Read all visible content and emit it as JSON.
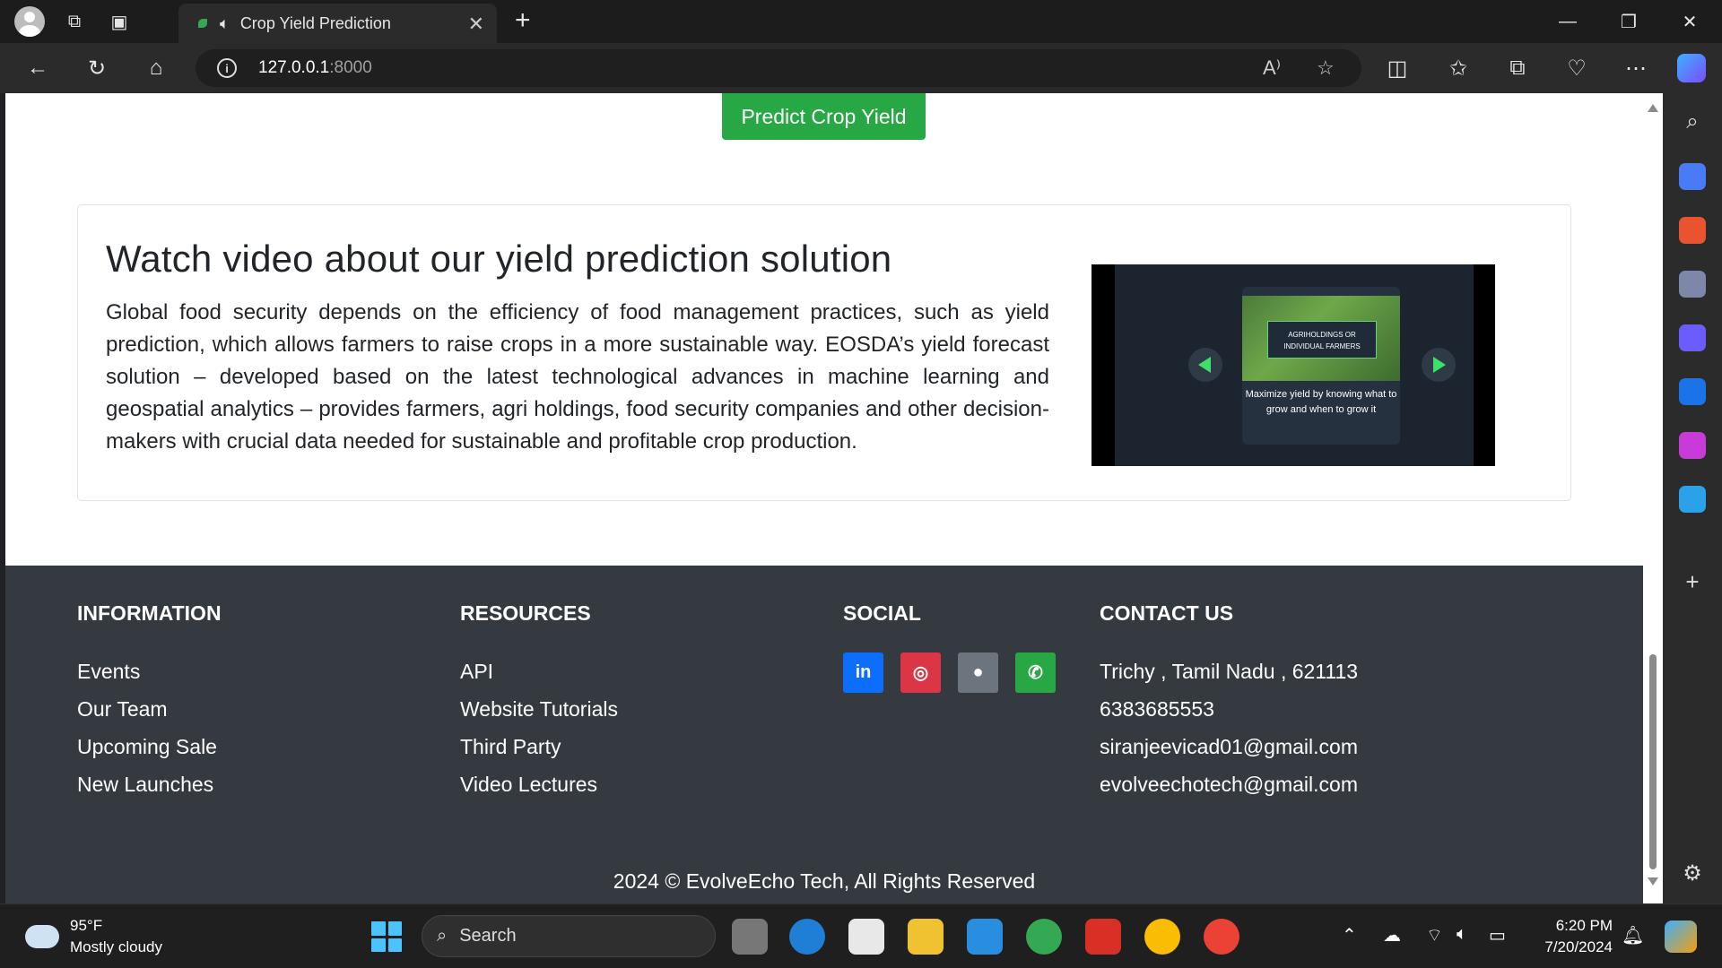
{
  "browser": {
    "tab_title": "Crop Yield Prediction",
    "url_host": "127.0.0.1",
    "url_port": ":8000"
  },
  "page": {
    "predict_button": "Predict Crop Yield",
    "video_section": {
      "heading": "Watch video about our yield prediction solution",
      "paragraph": "Global food security depends on the efficiency of food management practices, such as yield prediction, which allows farmers to raise crops in a more sustainable way. EOSDA’s yield forecast solution – developed based on the latest technological advances in machine learning and geospatial analytics – provides farmers, agri holdings, food security companies and other decision-makers with crucial data needed for sustainable and profitable crop production.",
      "video_tag": "AGRIHOLDINGS OR INDIVIDUAL FARMERS",
      "video_caption": "Maximize yield by knowing what to grow and when to grow it"
    },
    "footer": {
      "information": {
        "title": "INFORMATION",
        "links": [
          "Events",
          "Our Team",
          "Upcoming Sale",
          "New Launches"
        ]
      },
      "resources": {
        "title": "RESOURCES",
        "links": [
          "API",
          "Website Tutorials",
          "Third Party",
          "Video Lectures"
        ]
      },
      "social": {
        "title": "SOCIAL",
        "icons": [
          {
            "name": "linkedin-icon",
            "glyph": "in",
            "color": "#0d6efd"
          },
          {
            "name": "instagram-icon",
            "glyph": "◎",
            "color": "#dc3545"
          },
          {
            "name": "github-icon",
            "glyph": "●",
            "color": "#6c757d"
          },
          {
            "name": "whatsapp-icon",
            "glyph": "✆",
            "color": "#28a745"
          }
        ]
      },
      "contact": {
        "title": "CONTACT US",
        "lines": [
          "Trichy , Tamil Nadu , 621113",
          "6383685553",
          "siranjeevicad01@gmail.com",
          "evolveechotech@gmail.com"
        ]
      },
      "copyright": "2024 © EvolveEcho Tech, All Rights Reserved"
    }
  },
  "taskbar": {
    "weather_temp": "95°F",
    "weather_desc": "Mostly cloudy",
    "search_label": "Search",
    "time": "6:20 PM",
    "date": "7/20/2024"
  },
  "colors": {
    "accent_green": "#28a745",
    "footer_bg": "#343a40"
  }
}
